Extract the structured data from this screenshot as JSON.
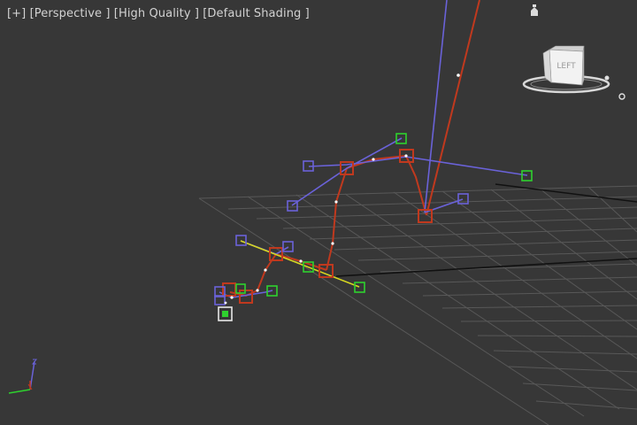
{
  "viewport": {
    "label": {
      "menu": "[+]",
      "view": "[Perspective ]",
      "quality": "[High Quality ]",
      "shading": "[Default Shading ]"
    },
    "viewcube_face": "LEFT",
    "icons": [
      "light-icon",
      "viewcube-icon",
      "axis-triad-icon"
    ],
    "colors": {
      "background": "#373737",
      "grid": "#595959",
      "bone_chain": "#c0391e",
      "blue_controls": "#6a62d8",
      "green_controls": "#2ed12e",
      "yellow_line": "#d8d820"
    }
  }
}
